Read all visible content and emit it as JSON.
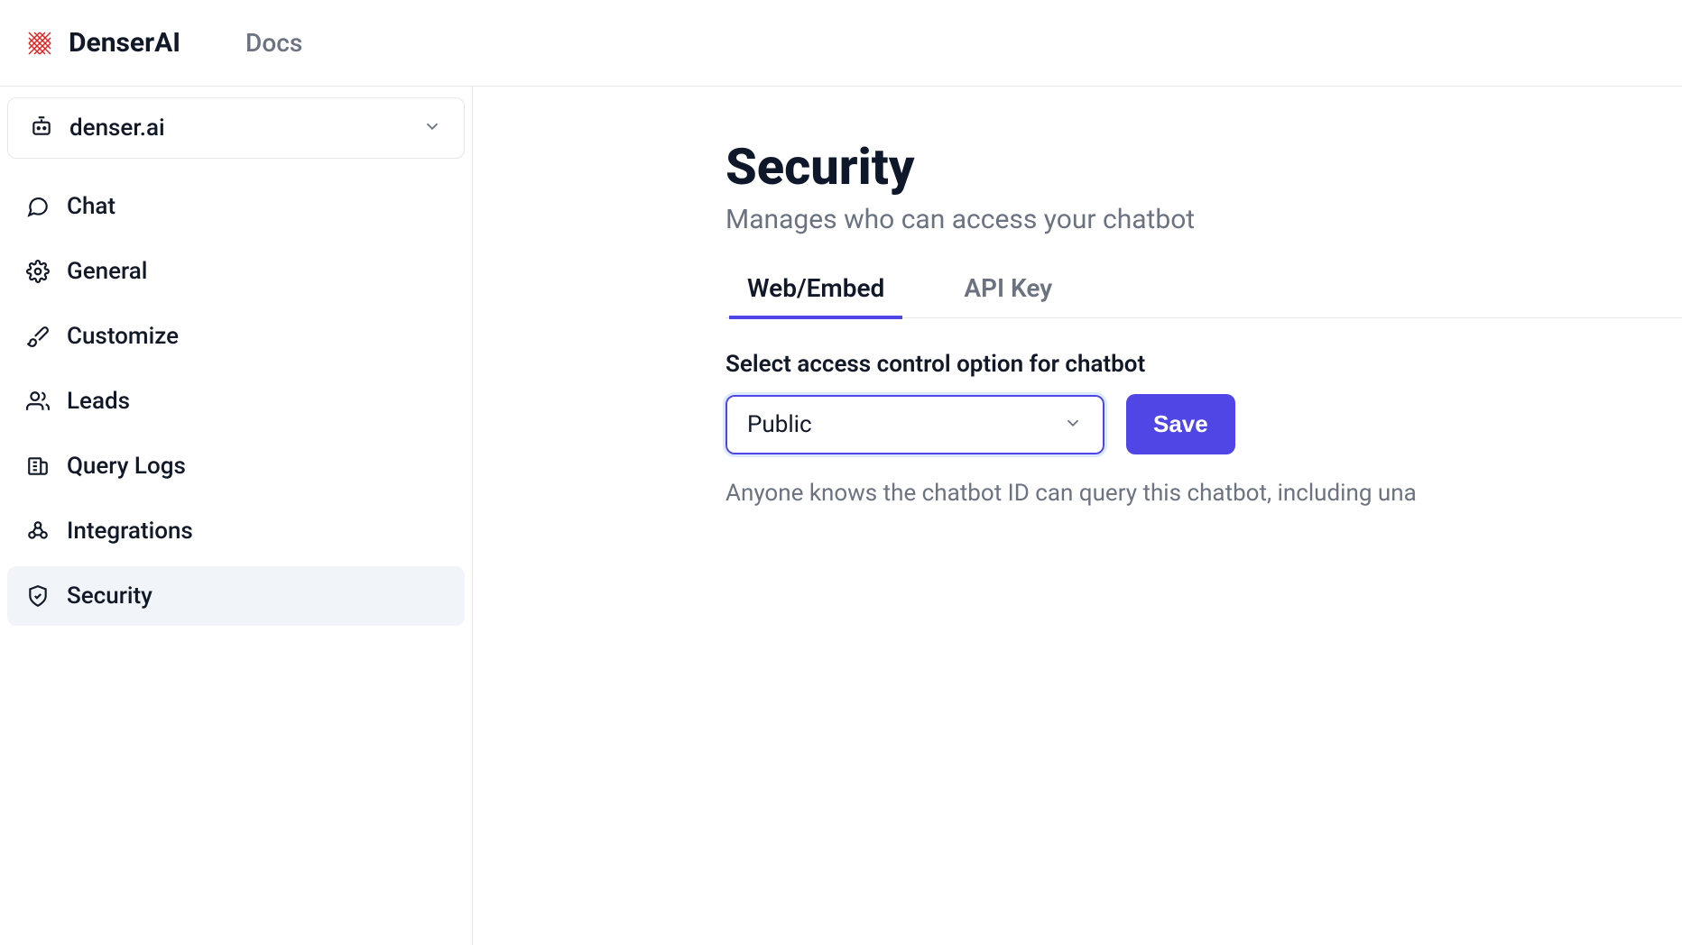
{
  "header": {
    "brand": "DenserAI",
    "docs_label": "Docs"
  },
  "sidebar": {
    "project_name": "denser.ai",
    "items": [
      {
        "label": "Chat",
        "icon": "chat-icon",
        "active": false
      },
      {
        "label": "General",
        "icon": "gear-icon",
        "active": false
      },
      {
        "label": "Customize",
        "icon": "brush-icon",
        "active": false
      },
      {
        "label": "Leads",
        "icon": "users-icon",
        "active": false
      },
      {
        "label": "Query Logs",
        "icon": "logs-icon",
        "active": false
      },
      {
        "label": "Integrations",
        "icon": "integrations-icon",
        "active": false
      },
      {
        "label": "Security",
        "icon": "shield-icon",
        "active": true
      }
    ]
  },
  "main": {
    "title": "Security",
    "subtitle": "Manages who can access your chatbot",
    "tabs": [
      {
        "label": "Web/Embed",
        "active": true
      },
      {
        "label": "API Key",
        "active": false
      }
    ],
    "form": {
      "label": "Select access control option for chatbot",
      "selected_option": "Public",
      "save_label": "Save",
      "hint": "Anyone knows the chatbot ID can query this chatbot, including una"
    }
  },
  "colors": {
    "accent": "#4f46e5",
    "brand_logo": "#dc2626"
  }
}
